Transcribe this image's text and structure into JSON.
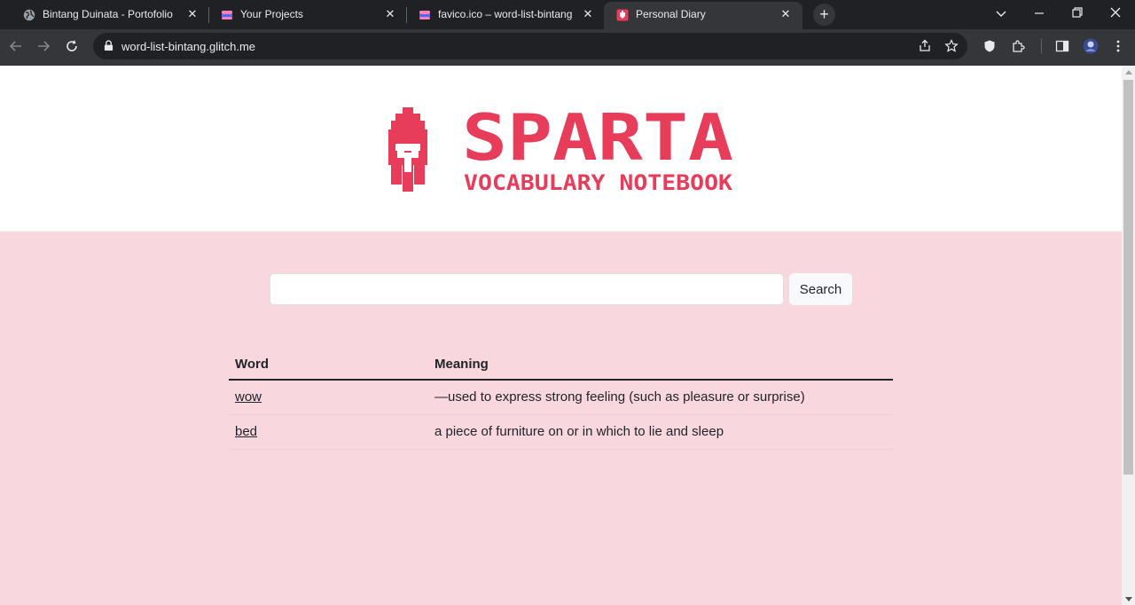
{
  "browser": {
    "tabs": [
      {
        "title": "Bintang Duinata - Portofolio",
        "icon": "globe-icon",
        "active": false
      },
      {
        "title": "Your Projects",
        "icon": "glitch-icon",
        "active": false
      },
      {
        "title": "favico.ico – word-list-bintang",
        "icon": "glitch-icon",
        "active": false
      },
      {
        "title": "Personal Diary",
        "icon": "diary-icon",
        "active": true
      }
    ],
    "close_glyph": "✕",
    "new_tab_glyph": "+",
    "url": "word-list-bintang.glitch.me"
  },
  "logo": {
    "title": "SPARTA",
    "subtitle": "VOCABULARY NOTEBOOK",
    "color": "#e73c5a"
  },
  "search": {
    "value": "",
    "button_label": "Search"
  },
  "table": {
    "headers": {
      "word": "Word",
      "meaning": "Meaning"
    },
    "rows": [
      {
        "word": "wow",
        "meaning": "—used to express strong feeling (such as pleasure or surprise)"
      },
      {
        "word": "bed",
        "meaning": "a piece of furniture on or in which to lie and sleep"
      }
    ]
  },
  "colors": {
    "page_bg": "#f8d7de",
    "banner_bg": "#ffffff",
    "brand": "#e73c5a"
  }
}
